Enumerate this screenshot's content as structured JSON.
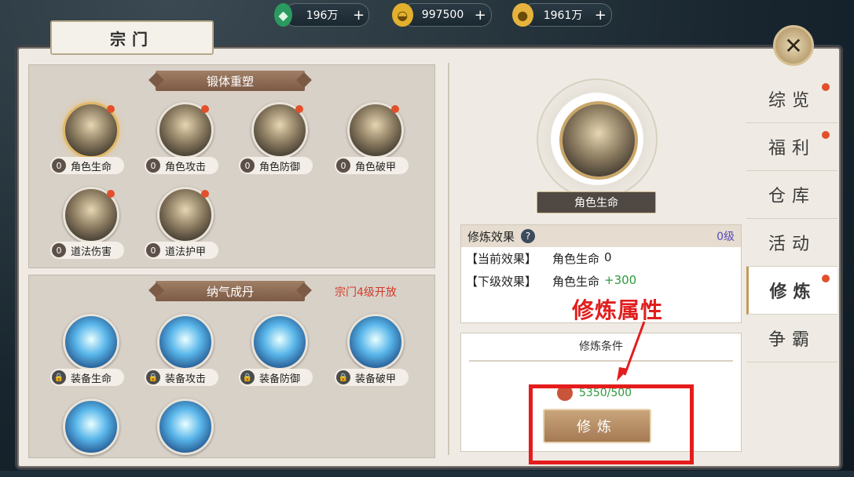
{
  "top_bar": {
    "currencies": [
      {
        "name": "jade",
        "value": "196万"
      },
      {
        "name": "gold-ingot",
        "value": "997500"
      },
      {
        "name": "coins",
        "value": "1961万"
      }
    ],
    "plus": "+"
  },
  "window": {
    "title": "宗门",
    "close": "✕"
  },
  "left": {
    "section1": {
      "title": "锻体重塑",
      "items": [
        {
          "level": "0",
          "label": "角色生命"
        },
        {
          "level": "0",
          "label": "角色攻击"
        },
        {
          "level": "0",
          "label": "角色防御"
        },
        {
          "level": "0",
          "label": "角色破甲"
        },
        {
          "level": "0",
          "label": "道法伤害"
        },
        {
          "level": "0",
          "label": "道法护甲"
        }
      ]
    },
    "section2": {
      "title": "纳气成丹",
      "unlock_note": "宗门4级开放",
      "items": [
        {
          "label": "装备生命"
        },
        {
          "label": "装备攻击"
        },
        {
          "label": "装备防御"
        },
        {
          "label": "装备破甲"
        }
      ]
    }
  },
  "detail": {
    "hero_label": "角色生命",
    "effect": {
      "header": "修炼效果",
      "help": "?",
      "level": "0级",
      "current_key": "【当前效果】",
      "current_name": "角色生命",
      "current_value": "0",
      "next_key": "【下级效果】",
      "next_name": "角色生命",
      "next_value": "+300"
    },
    "condition": {
      "title": "修炼条件",
      "requirement": "5350/500",
      "button": "修炼"
    },
    "annotation": "修炼属性"
  },
  "tabs": [
    {
      "label": "综览",
      "badge": true
    },
    {
      "label": "福利",
      "badge": true
    },
    {
      "label": "仓库",
      "badge": false
    },
    {
      "label": "活动",
      "badge": false
    },
    {
      "label": "修炼",
      "badge": true
    },
    {
      "label": "争霸",
      "badge": false
    }
  ],
  "colors": {
    "accent": "#c29a5a",
    "annotation_red": "#e01f1f",
    "badge_red": "#e2502b",
    "green_value": "#2c9a3c"
  }
}
